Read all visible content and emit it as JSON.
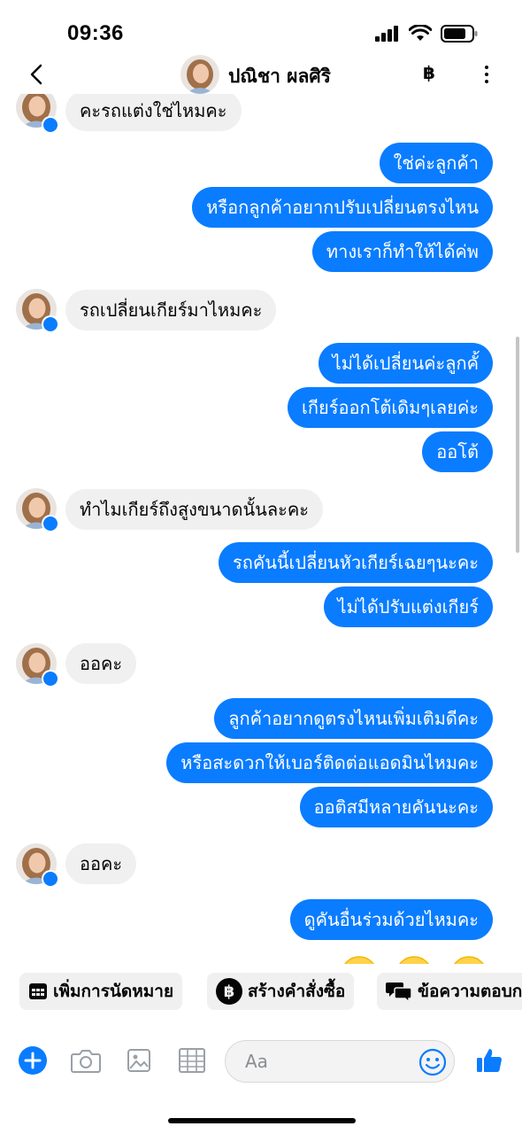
{
  "status_bar": {
    "time": "09:36"
  },
  "header": {
    "contact_name": "ปณิชา ผลศิริ",
    "baht_symbol": "฿"
  },
  "messages": [
    {
      "dir": "in",
      "text": "คะรถแต่งใช่ไหมคะ"
    },
    {
      "dir": "out",
      "text": "ใช่ค่ะลูกค้า"
    },
    {
      "dir": "out",
      "text": "หรือกลูกค้าอยากปรับเปลี่ยนตรงไหน"
    },
    {
      "dir": "out",
      "text": "ทางเราก็ทำให้ได้ค่พ"
    },
    {
      "dir": "in",
      "text": "รถเปลี่ยนเกียร์มาไหมคะ"
    },
    {
      "dir": "out",
      "text": "ไม่ได้เปลี่ยนค่ะลูกคั้"
    },
    {
      "dir": "out",
      "text": "เกียร์ออกโต้เดิมๆเลยค่ะ"
    },
    {
      "dir": "out",
      "text": "ออโต้"
    },
    {
      "dir": "in",
      "text": "ทำไมเกียร์ถึงสูงขนาดนั้นละคะ"
    },
    {
      "dir": "out",
      "text": "รถคันนี้เปลี่ยนหัวเกียร์เฉยๆนะคะ"
    },
    {
      "dir": "out",
      "text": "ไม่ได้ปรับแต่งเกียร์"
    },
    {
      "dir": "in",
      "text": "ออคะ"
    },
    {
      "dir": "out",
      "text": "ลูกค้าอยากดูตรงไหนเพิ่มเติมดีคะ"
    },
    {
      "dir": "out",
      "text": "หรือสะดวกให้เบอร์ติดต่อแอดมินไหมคะ"
    },
    {
      "dir": "out",
      "text": "ออติสมีหลายคันนะคะ"
    },
    {
      "dir": "in",
      "text": "ออคะ"
    },
    {
      "dir": "out",
      "text": "ดูคันอื่นร่วมด้วยไหมคะ"
    }
  ],
  "quick_actions": {
    "appointment": "เพิ่มการนัดหมาย",
    "order": "สร้างคำสั่งซื้อ",
    "saved_reply": "ข้อความตอบก",
    "order_icon_symbol": "฿"
  },
  "composer": {
    "placeholder": "Aa"
  },
  "colors": {
    "accent": "#0a7cff",
    "incoming_bubble": "#f0f0f0",
    "chip_bg": "#f0f0f0"
  }
}
